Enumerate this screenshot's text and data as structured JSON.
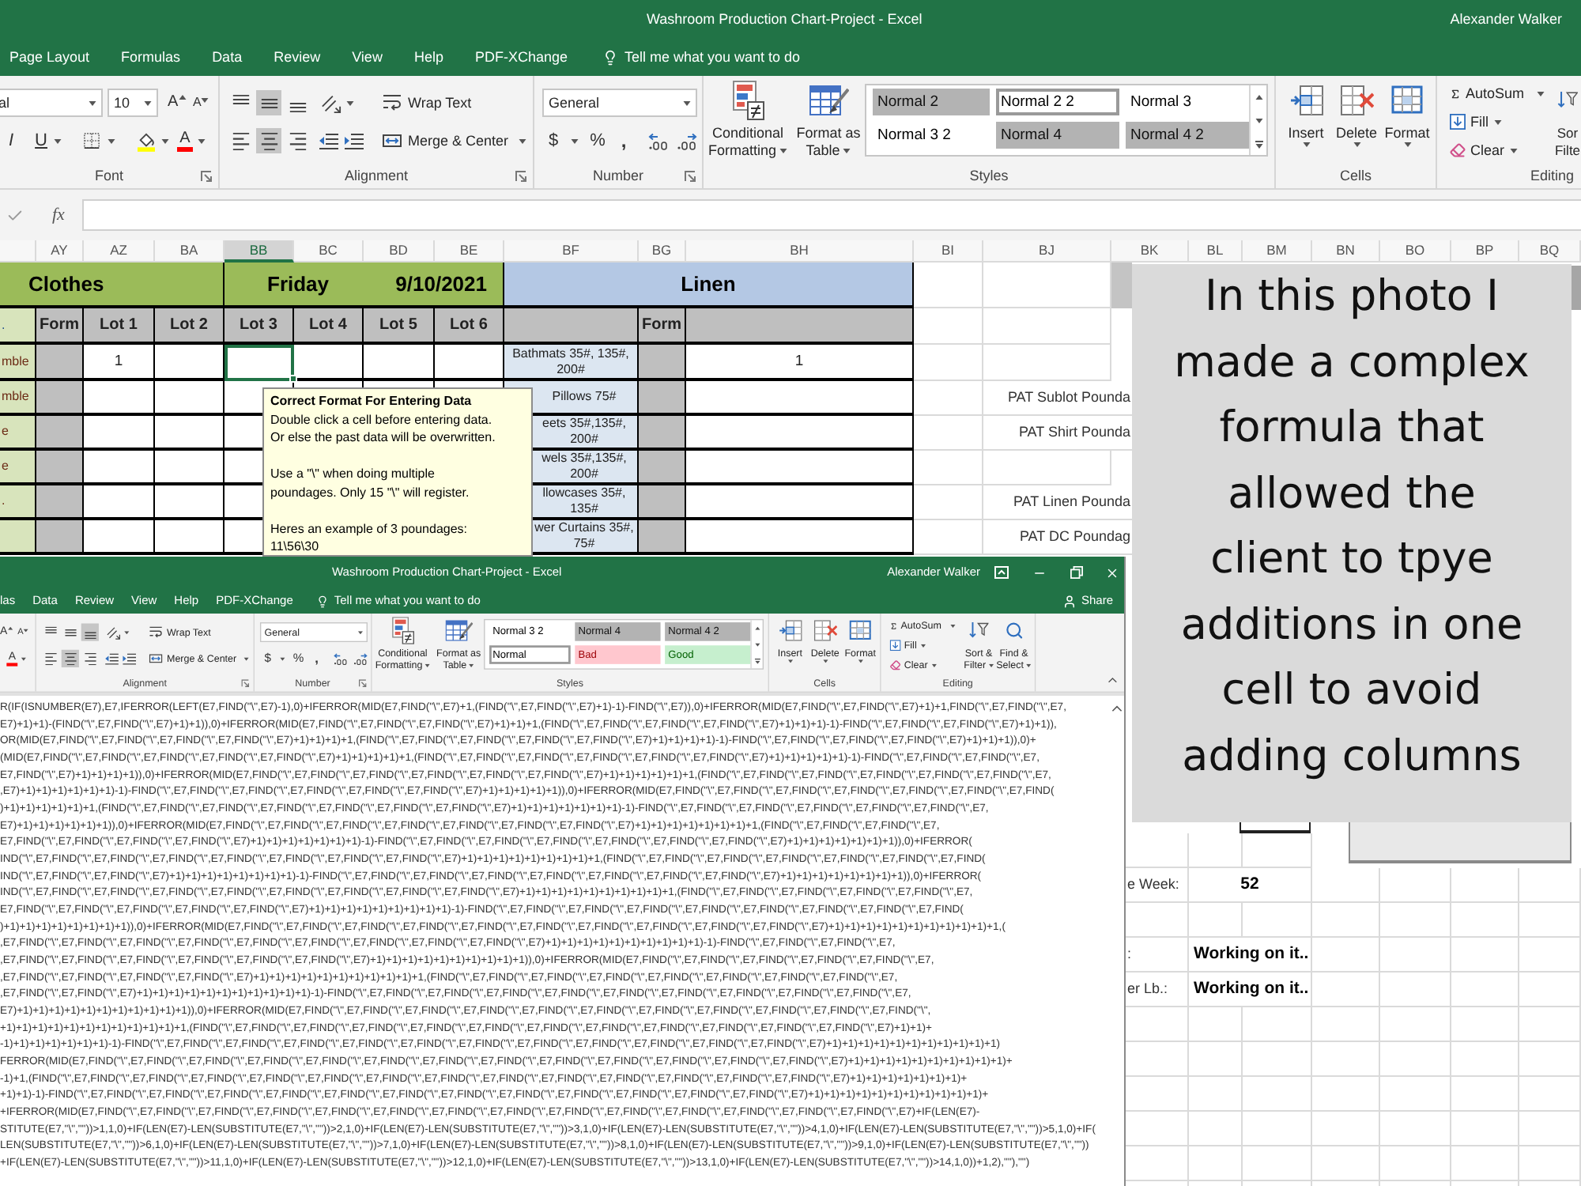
{
  "window": {
    "title": "Washroom Production Chart-Project - Excel",
    "user": "Alexander Walker"
  },
  "tabs": [
    {
      "label": "Page Layout",
      "selected": false
    },
    {
      "label": "Formulas",
      "selected": false
    },
    {
      "label": "Data",
      "selected": false
    },
    {
      "label": "Review",
      "selected": false
    },
    {
      "label": "View",
      "selected": false
    },
    {
      "label": "Help",
      "selected": false
    },
    {
      "label": "PDF-XChange",
      "selected": false
    }
  ],
  "tell_me": "Tell me what you want to do",
  "ribbon": {
    "font": {
      "name": "al",
      "size": "10",
      "grow": "A",
      "shrink": "A",
      "italic": "I",
      "underline": "U",
      "font_color": "A",
      "label": "Font"
    },
    "alignment": {
      "vertical": [
        {
          "kind": "top",
          "selected": false
        },
        {
          "kind": "middle",
          "selected": true
        },
        {
          "kind": "bottom",
          "selected": false
        }
      ],
      "horizontal": [
        {
          "kind": "left",
          "selected": false
        },
        {
          "kind": "center",
          "selected": true
        },
        {
          "kind": "right",
          "selected": false
        }
      ],
      "wrap_text": "Wrap Text",
      "merge": "Merge & Center",
      "label": "Alignment"
    },
    "number": {
      "format": "General",
      "currency": "$",
      "percent": "%",
      "comma": ",",
      "label": "Number"
    },
    "styles": {
      "conditional": [
        "Conditional",
        "Formatting"
      ],
      "table": [
        "Format as",
        "Table"
      ],
      "gallery": [
        {
          "label": "Normal 2",
          "kind": "shaded",
          "selected": false
        },
        {
          "label": "Normal 2 2",
          "kind": "plain",
          "selected": true
        },
        {
          "label": "Normal 3",
          "kind": "plain",
          "selected": false
        },
        {
          "label": "Normal 3 2",
          "kind": "plain",
          "selected": false
        },
        {
          "label": "Normal 4",
          "kind": "shaded",
          "selected": false
        },
        {
          "label": "Normal 4 2",
          "kind": "shaded",
          "selected": false
        }
      ],
      "label": "Styles"
    },
    "cells": {
      "buttons": [
        {
          "label": "Insert",
          "kind": "insert"
        },
        {
          "label": "Delete",
          "kind": "delete"
        },
        {
          "label": "Format",
          "kind": "format"
        }
      ],
      "label": "Cells"
    },
    "editing": {
      "autosum": "AutoSum",
      "fill": "Fill",
      "clear": "Clear",
      "sort": [
        "Sor",
        "Filte"
      ],
      "label": "Editing"
    }
  },
  "formula_bar": {
    "fx": "fx"
  },
  "sheet": {
    "columns": [
      {
        "label": "AY",
        "selected": false
      },
      {
        "label": "AZ",
        "selected": false
      },
      {
        "label": "BA",
        "selected": false
      },
      {
        "label": "BB",
        "selected": true
      },
      {
        "label": "BC",
        "selected": false
      },
      {
        "label": "BD",
        "selected": false
      },
      {
        "label": "BE",
        "selected": false
      },
      {
        "label": "BF",
        "selected": false
      },
      {
        "label": "BG",
        "selected": false
      },
      {
        "label": "BH",
        "selected": false
      },
      {
        "label": "BI",
        "selected": false
      },
      {
        "label": "BJ",
        "selected": false
      },
      {
        "label": "BK",
        "selected": false
      },
      {
        "label": "BL",
        "selected": false
      },
      {
        "label": "BM",
        "selected": false
      },
      {
        "label": "BN",
        "selected": false
      },
      {
        "label": "BO",
        "selected": false
      },
      {
        "label": "BP",
        "selected": false
      },
      {
        "label": "BQ",
        "selected": false
      }
    ],
    "bands": [
      {
        "label": "Clothes",
        "color": "#9bbb59"
      },
      {
        "label": "Friday",
        "date": "9/10/2021",
        "color": "#9bbb59"
      },
      {
        "label": "Linen",
        "color": "#b4c8e4"
      }
    ],
    "header": {
      "row_label": ".",
      "form": "Form",
      "lots": [
        "Lot 1",
        "Lot 2",
        "Lot 3",
        "Lot 4",
        "Lot 5",
        "Lot 6"
      ],
      "linen_form": "Form"
    },
    "rows": [
      {
        "label": "mble",
        "selected": true,
        "lot_1": "1",
        "linen": "Bathmats 35#, 135#, 200#",
        "linen_count": "1"
      },
      {
        "label": "mble",
        "selected": false,
        "linen": "Pillows 75#",
        "side_label": "PAT Sublot Pounda"
      },
      {
        "label": "e",
        "selected": false,
        "linen": "eets 35#,135#, 200#",
        "side_label": "PAT Shirt Pounda"
      },
      {
        "label": "e",
        "selected": false,
        "linen": "wels 35#,135#, 200#"
      },
      {
        "label": ".",
        "selected": false,
        "linen": "llowcases 35#, 135#",
        "side_label": "PAT Linen Pounda"
      },
      {
        "selected": false,
        "linen": "wer Curtains 35#, 75#",
        "side_label": "PAT DC Poundag"
      }
    ],
    "lower_rows": [
      {
        "label": "e Week:",
        "value": "52",
        "kind": "number"
      },
      {
        "label": ":",
        "value": "Working on it..",
        "kind": "text"
      },
      {
        "label": "er Lb.:",
        "value": "Working on it..",
        "kind": "text"
      }
    ]
  },
  "tooltip": {
    "title": "Correct Format For Entering Data",
    "paragraphs": [
      [
        "Double click a cell before entering data.",
        "Or else the past data will be overwritten."
      ],
      [
        "Use a \"\\\" when doing multiple",
        "poundages. Only 15 \"\\\" will register."
      ],
      [
        "Heres an example of 3 poundages:",
        "11\\56\\30"
      ]
    ]
  },
  "inset": {
    "window": {
      "title": "Washroom Production Chart-Project - Excel",
      "user": "Alexander Walker"
    },
    "tabs": [
      {
        "label": "las",
        "selected": false
      },
      {
        "label": "Data",
        "selected": false
      },
      {
        "label": "Review",
        "selected": false
      },
      {
        "label": "View",
        "selected": false
      },
      {
        "label": "Help",
        "selected": false
      },
      {
        "label": "PDF-XChange",
        "selected": false
      }
    ],
    "tell_me": "Tell me what you want to do",
    "share": "Share",
    "ribbon": {
      "font": {
        "grow": "A",
        "shrink": "A",
        "font_color": "A"
      },
      "alignment": {
        "vertical": [
          {
            "kind": "top",
            "selected": false
          },
          {
            "kind": "middle",
            "selected": false
          },
          {
            "kind": "bottom",
            "selected": true
          }
        ],
        "horizontal": [
          {
            "kind": "left",
            "selected": false
          },
          {
            "kind": "center",
            "selected": true
          },
          {
            "kind": "right",
            "selected": false
          }
        ],
        "wrap_text": "Wrap Text",
        "merge": "Merge & Center",
        "label": "Alignment"
      },
      "number": {
        "format": "General",
        "currency": "$",
        "percent": "%",
        "comma": ",",
        "label": "Number"
      },
      "styles": {
        "conditional": [
          "Conditional",
          "Formatting"
        ],
        "table": [
          "Format as",
          "Table"
        ],
        "gallery": [
          {
            "label": "Normal 3 2",
            "kind": "plain",
            "selected": false
          },
          {
            "label": "Normal 4",
            "kind": "shaded",
            "selected": false
          },
          {
            "label": "Normal 4 2",
            "kind": "shaded",
            "selected": false
          },
          {
            "label": "Normal",
            "kind": "plain",
            "selected": true
          },
          {
            "label": "Bad",
            "kind": "bad",
            "selected": false
          },
          {
            "label": "Good",
            "kind": "good",
            "selected": false
          }
        ],
        "label": "Styles"
      },
      "cells": {
        "buttons": [
          {
            "label": "Insert",
            "kind": "insert"
          },
          {
            "label": "Delete",
            "kind": "delete"
          },
          {
            "label": "Format",
            "kind": "format"
          }
        ],
        "label": "Cells"
      },
      "editing": {
        "autosum": "AutoSum",
        "fill": "Fill",
        "clear": "Clear",
        "sort": [
          "Sort &",
          "Filter"
        ],
        "find": [
          "Find &",
          "Select"
        ],
        "label": "Editing"
      }
    },
    "formula_lines": [
      "R(IF(ISNUMBER(E7),E7,IFERROR(LEFT(E7,FIND(\"\\\",E7)-1),0)+IFERROR(MID(E7,FIND(\"\\\",E7)+1,(FIND(\"\\\",E7,FIND(\"\\\",E7)+1)-1)-FIND(\"\\\",E7)),0)+IFERROR(MID(E7,FIND(\"\\\",E7,FIND(\"\\\",E7)+1)+1,FIND(\"\\\",E7,FIND(\"\\\",E7,",
      "E7)+1)+1)-(FIND(\"\\\",E7,FIND(\"\\\",E7)+1)+1)),0)+IFERROR(MID(E7,FIND(\"\\\",E7,FIND(\"\\\",E7,FIND(\"\\\",E7)+1)+1)+1,(FIND(\"\\\",E7,FIND(\"\\\",E7,FIND(\"\\\",E7,FIND(\"\\\",E7)+1)+1)+1)-1)-FIND(\"\\\",E7,FIND(\"\\\",E7,FIND(\"\\\",E7)+1)+1)),",
      "OR(MID(E7,FIND(\"\\\",E7,FIND(\"\\\",E7,FIND(\"\\\",E7,FIND(\"\\\",E7)+1)+1)+1)+1,(FIND(\"\\\",E7,FIND(\"\\\",E7,FIND(\"\\\",E7,FIND(\"\\\",E7,FIND(\"\\\",E7)+1)+1)+1)+1)-1)-FIND(\"\\\",E7,FIND(\"\\\",E7,FIND(\"\\\",E7,FIND(\"\\\",E7)+1)+1)+1)),0)+",
      "(MID(E7,FIND(\"\\\",E7,FIND(\"\\\",E7,FIND(\"\\\",E7,FIND(\"\\\",E7,FIND(\"\\\",E7)+1)+1)+1)+1)+1,(FIND(\"\\\",E7,FIND(\"\\\",E7,FIND(\"\\\",E7,FIND(\"\\\",E7,FIND(\"\\\",E7,FIND(\"\\\",E7)+1)+1)+1)+1)+1)-1)-FIND(\"\\\",E7,FIND(\"\\\",E7,FIND(\"\\\",E7,",
      "E7,FIND(\"\\\",E7)+1)+1)+1)+1)),0)+IFERROR(MID(E7,FIND(\"\\\",E7,FIND(\"\\\",E7,FIND(\"\\\",E7,FIND(\"\\\",E7,FIND(\"\\\",E7,FIND(\"\\\",E7)+1)+1)+1)+1)+1)+1,(FIND(\"\\\",E7,FIND(\"\\\",E7,FIND(\"\\\",E7,FIND(\"\\\",E7,FIND(\"\\\",E7,FIND(\"\\\",E7,",
      ",E7)+1)+1)+1)+1)+1)+1)-1)-FIND(\"\\\",E7,FIND(\"\\\",E7,FIND(\"\\\",E7,FIND(\"\\\",E7,FIND(\"\\\",E7,FIND(\"\\\",E7)+1)+1)+1)+1)+1)),0)+IFERROR(MID(E7,FIND(\"\\\",E7,FIND(\"\\\",E7,FIND(\"\\\",E7,FIND(\"\\\",E7,FIND(\"\\\",E7,FIND(\"\\\",E7,FIND(",
      ")+1)+1)+1)+1)+1)+1,(FIND(\"\\\",E7,FIND(\"\\\",E7,FIND(\"\\\",E7,FIND(\"\\\",E7,FIND(\"\\\",E7,FIND(\"\\\",E7,FIND(\"\\\",E7)+1)+1)+1)+1)+1)+1)+1)-1)-FIND(\"\\\",E7,FIND(\"\\\",E7,FIND(\"\\\",E7,FIND(\"\\\",E7,FIND(\"\\\",E7,FIND(\"\\\",E7,",
      "E7)+1)+1)+1)+1)+1)+1)),0)+IFERROR(MID(E7,FIND(\"\\\",E7,FIND(\"\\\",E7,FIND(\"\\\",E7,FIND(\"\\\",E7,FIND(\"\\\",E7,FIND(\"\\\",E7,FIND(\"\\\",E7)+1)+1)+1)+1)+1)+1)+1)+1,(FIND(\"\\\",E7,FIND(\"\\\",E7,FIND(\"\\\",E7,",
      "E7,FIND(\"\\\",E7,FIND(\"\\\",E7,FIND(\"\\\",E7,FIND(\"\\\",E7)+1)+1)+1)+1)+1)+1)+1)-1)-FIND(\"\\\",E7,FIND(\"\\\",E7,FIND(\"\\\",E7,FIND(\"\\\",E7,FIND(\"\\\",E7,FIND(\"\\\",E7,FIND(\"\\\",E7)+1)+1)+1)+1)+1)+1)+1)),0)+IFERROR(",
      "IND(\"\\\",E7,FIND(\"\\\",E7,FIND(\"\\\",E7,FIND(\"\\\",E7,FIND(\"\\\",E7,FIND(\"\\\",E7,FIND(\"\\\",E7,FIND(\"\\\",E7)+1)+1)+1)+1)+1)+1)+1)+1)+1,(FIND(\"\\\",E7,FIND(\"\\\",E7,FIND(\"\\\",E7,FIND(\"\\\",E7,FIND(\"\\\",E7,FIND(\"\\\",E7,FIND(",
      "IND(\"\\\",E7,FIND(\"\\\",E7,FIND(\"\\\",E7)+1)+1)+1)+1)+1)+1)+1)+1)-1)-FIND(\"\\\",E7,FIND(\"\\\",E7,FIND(\"\\\",E7,FIND(\"\\\",E7,FIND(\"\\\",E7,FIND(\"\\\",E7,FIND(\"\\\",E7,FIND(\"\\\",E7)+1)+1)+1)+1)+1)+1)+1)+1)),0)+IFERROR(",
      "IND(\"\\\",E7,FIND(\"\\\",E7,FIND(\"\\\",E7,FIND(\"\\\",E7,FIND(\"\\\",E7,FIND(\"\\\",E7,FIND(\"\\\",E7,FIND(\"\\\",E7,FIND(\"\\\",E7)+1)+1)+1)+1)+1)+1)+1)+1)+1)+1,(FIND(\"\\\",E7,FIND(\"\\\",E7,FIND(\"\\\",E7,FIND(\"\\\",E7,FIND(\"\\\",E7,",
      "E7,FIND(\"\\\",E7,FIND(\"\\\",E7,FIND(\"\\\",E7,FIND(\"\\\",E7,FIND(\"\\\",E7)+1)+1)+1)+1)+1)+1)+1)+1)+1)-1)-FIND(\"\\\",E7,FIND(\"\\\",E7,FIND(\"\\\",E7,FIND(\"\\\",E7,FIND(\"\\\",E7,FIND(\"\\\",E7,FIND(\"\\\",E7,FIND(\"\\\",E7,FIND(",
      ")+1)+1)+1)+1)+1)+1)+1)+1)),0)+IFERROR(MID(E7,FIND(\"\\\",E7,FIND(\"\\\",E7,FIND(\"\\\",E7,FIND(\"\\\",E7,FIND(\"\\\",E7,FIND(\"\\\",E7,FIND(\"\\\",E7,FIND(\"\\\",E7,FIND(\"\\\",E7,FIND(\"\\\",E7)+1)+1)+1)+1)+1)+1)+1)+1)+1)+1)+1,(",
      ",E7,FIND(\"\\\",E7,FIND(\"\\\",E7,FIND(\"\\\",E7,FIND(\"\\\",E7,FIND(\"\\\",E7,FIND(\"\\\",E7,FIND(\"\\\",E7,FIND(\"\\\",E7,FIND(\"\\\",E7)+1)+1)+1)+1)+1)+1)+1)+1)+1)+1)-1)-FIND(\"\\\",E7,FIND(\"\\\",E7,FIND(\"\\\",E7,",
      ",E7,FIND(\"\\\",E7,FIND(\"\\\",E7,FIND(\"\\\",E7,FIND(\"\\\",E7,FIND(\"\\\",E7,FIND(\"\\\",E7)+1)+1)+1)+1)+1)+1)+1)+1)+1)+1)),0)+IFERROR(MID(E7,FIND(\"\\\",E7,FIND(\"\\\",E7,FIND(\"\\\",E7,FIND(\"\\\",E7,FIND(\"\\\",E7,",
      ",E7,FIND(\"\\\",E7,FIND(\"\\\",E7,FIND(\"\\\",E7,FIND(\"\\\",E7)+1)+1)+1)+1)+1)+1)+1)+1)+1)+1)+1,(FIND(\"\\\",E7,FIND(\"\\\",E7,FIND(\"\\\",E7,FIND(\"\\\",E7,FIND(\"\\\",E7,FIND(\"\\\",E7,FIND(\"\\\",E7,FIND(\"\\\",E7,",
      ",E7,FIND(\"\\\",E7,FIND(\"\\\",E7)+1)+1)+1)+1)+1)+1)+1)+1)+1)+1)+1)-1)-FIND(\"\\\",E7,FIND(\"\\\",E7,FIND(\"\\\",E7,FIND(\"\\\",E7,FIND(\"\\\",E7,FIND(\"\\\",E7,FIND(\"\\\",E7,FIND(\"\\\",E7,FIND(\"\\\",E7,FIND(\"\\\",E7,",
      "E7)+1)+1)+1)+1)+1)+1)+1)+1)+1)+1)+1)),0)+IFERROR(MID(E7,FIND(\"\\\",E7,FIND(\"\\\",E7,FIND(\"\\\",E7,FIND(\"\\\",E7,FIND(\"\\\",E7,FIND(\"\\\",E7,FIND(\"\\\",E7,FIND(\"\\\",E7,FIND(\"\\\",E7,FIND(\"\\\",E7,FIND(\"\\\",",
      "+1)+1)+1)+1)+1)+1)+1)+1)+1)+1)+1)+1,(FIND(\"\\\",E7,FIND(\"\\\",E7,FIND(\"\\\",E7,FIND(\"\\\",E7,FIND(\"\\\",E7,FIND(\"\\\",E7,FIND(\"\\\",E7,FIND(\"\\\",E7,FIND(\"\\\",E7,FIND(\"\\\",E7,FIND(\"\\\",E7,FIND(\"\\\",E7)+1)+1)+",
      "-1)+1)+1)+1)+1)+1)+1)-1)-FIND(\"\\\",E7,FIND(\"\\\",E7,FIND(\"\\\",E7,FIND(\"\\\",E7,FIND(\"\\\",E7,FIND(\"\\\",E7,FIND(\"\\\",E7,FIND(\"\\\",E7,FIND(\"\\\",E7,FIND(\"\\\",E7,FIND(\"\\\",E7,FIND(\"\\\",E7)+1)+1)+1)+1)+1)+1)+1)+1)+1)+1)+1)",
      "FERROR(MID(E7,FIND(\"\\\",E7,FIND(\"\\\",E7,FIND(\"\\\",E7,FIND(\"\\\",E7,FIND(\"\\\",E7,FIND(\"\\\",E7,FIND(\"\\\",E7,FIND(\"\\\",E7,FIND(\"\\\",E7,FIND(\"\\\",E7,FIND(\"\\\",E7,FIND(\"\\\",E7,FIND(\"\\\",E7)+1)+1)+1)+1)+1)+1)+1)+1)+1)+1)+",
      "-1)+1,(FIND(\"\\\",E7,FIND(\"\\\",E7,FIND(\"\\\",E7,FIND(\"\\\",E7,FIND(\"\\\",E7,FIND(\"\\\",E7,FIND(\"\\\",E7,FIND(\"\\\",E7,FIND(\"\\\",E7,FIND(\"\\\",E7,FIND(\"\\\",E7,FIND(\"\\\",E7,FIND(\"\\\",E7,FIND(\"\\\",E7)+1)+1)+1)+1)+1)+1)+1)+",
      "+1)+1)-1)-FIND(\"\\\",E7,FIND(\"\\\",E7,FIND(\"\\\",E7,FIND(\"\\\",E7,FIND(\"\\\",E7,FIND(\"\\\",E7,FIND(\"\\\",E7,FIND(\"\\\",E7,FIND(\"\\\",E7,FIND(\"\\\",E7,FIND(\"\\\",E7,FIND(\"\\\",E7,FIND(\"\\\",E7)+1)+1)+1)+1)+1)+1)+1)+1)+1)+1)+1)+",
      "+IFERROR(MID(E7,FIND(\"\\\",E7,FIND(\"\\\",E7,FIND(\"\\\",E7,FIND(\"\\\",E7,FIND(\"\\\",E7,FIND(\"\\\",E7,FIND(\"\\\",E7,FIND(\"\\\",E7,FIND(\"\\\",E7,FIND(\"\\\",E7,FIND(\"\\\",E7,FIND(\"\\\",E7,FIND(\"\\\",E7,FIND(\"\\\",E7)+IF(LEN(E7)-",
      "STITUTE(E7,\"\\\",\"\"))>1,1,0)+IF(LEN(E7)-LEN(SUBSTITUTE(E7,\"\\\",\"\"))>2,1,0)+IF(LEN(E7)-LEN(SUBSTITUTE(E7,\"\\\",\"\"))>3,1,0)+IF(LEN(E7)-LEN(SUBSTITUTE(E7,\"\\\",\"\"))>4,1,0)+IF(LEN(E7)-LEN(SUBSTITUTE(E7,\"\\\",\"\"))>5,1,0)+IF(",
      "LEN(SUBSTITUTE(E7,\"\\\",\"\"))>6,1,0)+IF(LEN(E7)-LEN(SUBSTITUTE(E7,\"\\\",\"\"))>7,1,0)+IF(LEN(E7)-LEN(SUBSTITUTE(E7,\"\\\",\"\"))>8,1,0)+IF(LEN(E7)-LEN(SUBSTITUTE(E7,\"\\\",\"\"))>9,1,0)+IF(LEN(E7)-LEN(SUBSTITUTE(E7,\"\\\",\"\"))",
      "+IF(LEN(E7)-LEN(SUBSTITUTE(E7,\"\\\",\"\"))>11,1,0)+IF(LEN(E7)-LEN(SUBSTITUTE(E7,\"\\\",\"\"))>12,1,0)+IF(LEN(E7)-LEN(SUBSTITUTE(E7,\"\\\",\"\"))>13,1,0)+IF(LEN(E7)-LEN(SUBSTITUTE(E7,\"\\\",\"\"))>14,1,0))+1,2),\"\"),\"\")"
    ]
  },
  "caption": {
    "lines": [
      "In this photo I",
      "made a complex",
      "formula that",
      "allowed the",
      "client to tpye",
      "additions in one",
      "cell to avoid",
      "adding columns"
    ]
  }
}
